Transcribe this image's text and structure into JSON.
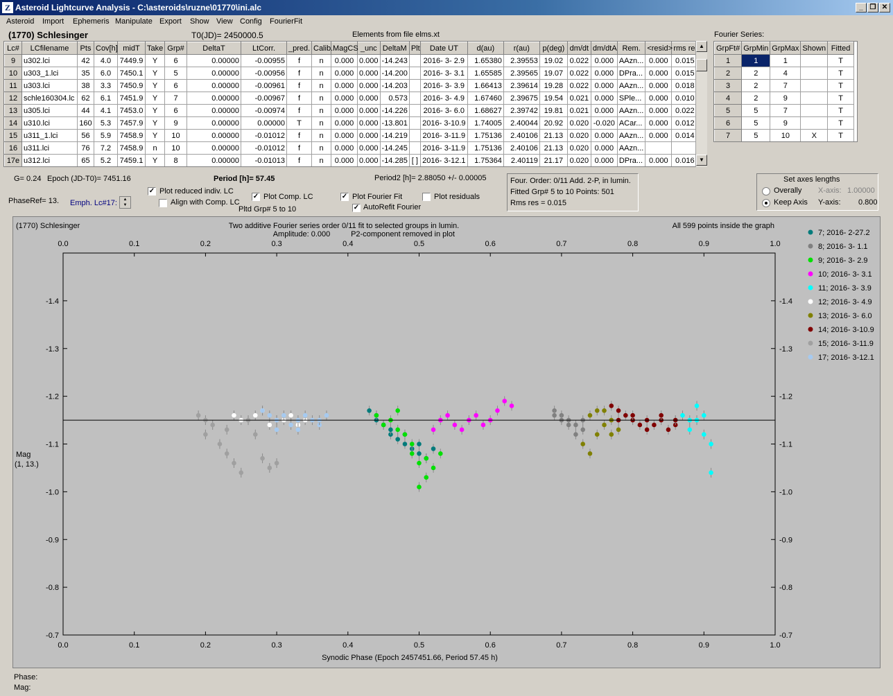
{
  "window": {
    "title": "Asteroid Lightcurve Analysis - C:\\asteroids\\ruzne\\01770\\ini.alc",
    "icon_text": "Z"
  },
  "menu": [
    "Asteroid",
    "Import",
    "Ephemeris",
    "Manipulate",
    "Export",
    "Show",
    "View",
    "Config",
    "FourierFit"
  ],
  "header": {
    "asteroid": "(1770) Schlesinger",
    "t0": "T0(JD)= 2450000.5",
    "elements": "Elements from file elms.xt"
  },
  "lc_table": {
    "columns": [
      "Lc#",
      "LCfilename",
      "Pts",
      "Cov[h]",
      "midT",
      "Take",
      "Grp#",
      "DeltaT",
      "LtCorr.",
      "_pred.",
      "Calib.",
      "MagCS",
      "_unc",
      "DeltaM",
      "Plt",
      "Date UT",
      "d(au)",
      "r(au)",
      "p(deg)",
      "dm/dt",
      "dm/dtA",
      "Rem.",
      "<resid>",
      "rms res"
    ],
    "rows": [
      [
        "9",
        "u302.lci",
        "42",
        "4.0",
        "7449.9",
        "Y",
        "6",
        "0.00000",
        "-0.00955",
        "f",
        "n",
        "0.000",
        "0.000",
        "-14.243",
        "",
        "2016- 3- 2.9",
        "1.65380",
        "2.39553",
        "19.02",
        "0.022",
        "0.000",
        "AAzn...",
        "0.000",
        "0.015"
      ],
      [
        "10",
        "u303_1.lci",
        "35",
        "6.0",
        "7450.1",
        "Y",
        "5",
        "0.00000",
        "-0.00956",
        "f",
        "n",
        "0.000",
        "0.000",
        "-14.200",
        "",
        "2016- 3- 3.1",
        "1.65585",
        "2.39565",
        "19.07",
        "0.022",
        "0.000",
        "DPra...",
        "0.000",
        "0.015"
      ],
      [
        "11",
        "u303.lci",
        "38",
        "3.3",
        "7450.9",
        "Y",
        "6",
        "0.00000",
        "-0.00961",
        "f",
        "n",
        "0.000",
        "0.000",
        "-14.203",
        "",
        "2016- 3- 3.9",
        "1.66413",
        "2.39614",
        "19.28",
        "0.022",
        "0.000",
        "AAzn...",
        "0.000",
        "0.018"
      ],
      [
        "12",
        "schle160304.lc",
        "62",
        "6.1",
        "7451.9",
        "Y",
        "7",
        "0.00000",
        "-0.00967",
        "f",
        "n",
        "0.000",
        "0.000",
        "0.573",
        "",
        "2016- 3- 4.9",
        "1.67460",
        "2.39675",
        "19.54",
        "0.021",
        "0.000",
        "SPle...",
        "0.000",
        "0.010"
      ],
      [
        "13",
        "u305.lci",
        "44",
        "4.1",
        "7453.0",
        "Y",
        "6",
        "0.00000",
        "-0.00974",
        "f",
        "n",
        "0.000",
        "0.000",
        "-14.226",
        "",
        "2016- 3- 6.0",
        "1.68627",
        "2.39742",
        "19.81",
        "0.021",
        "0.000",
        "AAzn...",
        "0.000",
        "0.022"
      ],
      [
        "14",
        "u310.lci",
        "160",
        "5.3",
        "7457.9",
        "Y",
        "9",
        "0.00000",
        "0.00000",
        "T",
        "n",
        "0.000",
        "0.000",
        "-13.801",
        "",
        "2016- 3-10.9",
        "1.74005",
        "2.40044",
        "20.92",
        "0.020",
        "-0.020",
        "ACar...",
        "0.000",
        "0.012"
      ],
      [
        "15",
        "u311_1.lci",
        "56",
        "5.9",
        "7458.9",
        "Y",
        "10",
        "0.00000",
        "-0.01012",
        "f",
        "n",
        "0.000",
        "0.000",
        "-14.219",
        "",
        "2016- 3-11.9",
        "1.75136",
        "2.40106",
        "21.13",
        "0.020",
        "0.000",
        "AAzn...",
        "0.000",
        "0.014"
      ],
      [
        "16",
        "u311.lci",
        "76",
        "7.2",
        "7458.9",
        "n",
        "10",
        "0.00000",
        "-0.01012",
        "f",
        "n",
        "0.000",
        "0.000",
        "-14.245",
        "",
        "2016- 3-11.9",
        "1.75136",
        "2.40106",
        "21.13",
        "0.020",
        "0.000",
        "AAzn...",
        "",
        ""
      ],
      [
        "17e",
        "u312.lci",
        "65",
        "5.2",
        "7459.1",
        "Y",
        "8",
        "0.00000",
        "-0.01013",
        "f",
        "n",
        "0.000",
        "0.000",
        "-14.285",
        "[ ]",
        "2016- 3-12.1",
        "1.75364",
        "2.40119",
        "21.17",
        "0.020",
        "0.000",
        "DPra...",
        "0.000",
        "0.016"
      ]
    ]
  },
  "fourier_table": {
    "caption": "Fourier Series:",
    "columns": [
      "GrpFt#",
      "GrpMin",
      "GrpMax",
      "Shown",
      "Fitted"
    ],
    "rows": [
      [
        "1",
        "1",
        "1",
        "",
        "T"
      ],
      [
        "2",
        "2",
        "4",
        "",
        "T"
      ],
      [
        "3",
        "2",
        "7",
        "",
        "T"
      ],
      [
        "4",
        "2",
        "9",
        "",
        "T"
      ],
      [
        "5",
        "5",
        "7",
        "",
        "T"
      ],
      [
        "6",
        "5",
        "9",
        "",
        "T"
      ],
      [
        "7",
        "5",
        "10",
        "X",
        "T"
      ]
    ]
  },
  "controls": {
    "g_value": "G= 0.24",
    "epoch": "Epoch (JD-T0)= 7451.16",
    "period": "Period [h]= 57.45",
    "period2": "Period2 [h]= 2.88050 +/- 0.00005",
    "phaseref": "PhaseRef= 13.",
    "emph": "Emph. Lc#17:",
    "plot_reduced": "Plot reduced indiv. LC",
    "align_comp": "Align with Comp. LC",
    "plot_comp": "Plot Comp. LC",
    "pltd_grp": "Pltd Grp#  5   to   10",
    "plot_fourier": "Plot Fourier Fit",
    "autorefit": "AutoRefit Fourier",
    "plot_residuals": "Plot residuals",
    "info1": "Four. Order:  0/11    Add. 2-P, in lumin.",
    "info2": "Fitted Grp# 5 to 10   Points: 501",
    "info3": "Rms res      = 0.015",
    "axes_title": "Set axes lengths",
    "overally": "Overally",
    "keep_axis": "Keep Axis",
    "xaxis_label": "X-axis:",
    "xaxis_val": "1.00000",
    "yaxis_label": "Y-axis:",
    "yaxis_val": "0.800",
    "check_mark": "✓",
    "phase": "Phase:",
    "mag": "Mag:"
  },
  "plot": {
    "name": "(1770) Schlesinger",
    "title1": "Two additive Fourier series order 0/11 fit to selected groups in lumin.",
    "title2": "Amplitude: 0.000",
    "title3": "P2-component removed in plot",
    "count": "All 599 points inside the graph",
    "xlabel": "Synodic Phase (Epoch 2457451.66, Period 57.45 h)",
    "ylabel1": "Mag",
    "ylabel2": "(1, 13.)"
  },
  "chart_data": {
    "type": "scatter",
    "xlim": [
      0,
      1
    ],
    "ylim": [
      -1.5,
      -0.7
    ],
    "y_inverted": true,
    "x_ticks": [
      "0.0",
      "0.1",
      "0.2",
      "0.3",
      "0.4",
      "0.5",
      "0.6",
      "0.7",
      "0.8",
      "0.9",
      "1.0"
    ],
    "y_ticks": [
      "-1.4",
      "-1.3",
      "-1.2",
      "-1.1",
      "-1.0",
      "-0.9",
      "-0.8",
      "-0.7"
    ],
    "fit_line_y": -1.15,
    "series": [
      {
        "name": "7; 2016- 2-27.2",
        "color": "#007b7b",
        "points": [
          [
            0.43,
            -1.17
          ],
          [
            0.44,
            -1.16
          ],
          [
            0.45,
            -1.14
          ],
          [
            0.46,
            -1.12
          ],
          [
            0.47,
            -1.11
          ],
          [
            0.48,
            -1.1
          ],
          [
            0.49,
            -1.09
          ],
          [
            0.5,
            -1.08
          ],
          [
            0.51,
            -1.07
          ],
          [
            0.52,
            -1.09
          ],
          [
            0.44,
            -1.15
          ],
          [
            0.46,
            -1.13
          ],
          [
            0.48,
            -1.12
          ],
          [
            0.5,
            -1.1
          ]
        ]
      },
      {
        "name": "8; 2016- 3- 1.1",
        "color": "#808080",
        "points": [
          [
            0.69,
            -1.17
          ],
          [
            0.7,
            -1.16
          ],
          [
            0.71,
            -1.15
          ],
          [
            0.72,
            -1.14
          ],
          [
            0.73,
            -1.13
          ],
          [
            0.7,
            -1.15
          ],
          [
            0.72,
            -1.12
          ],
          [
            0.71,
            -1.14
          ],
          [
            0.69,
            -1.16
          ],
          [
            0.73,
            -1.15
          ]
        ]
      },
      {
        "name": "9; 2016- 3- 2.9",
        "color": "#00e000",
        "points": [
          [
            0.44,
            -1.16
          ],
          [
            0.46,
            -1.15
          ],
          [
            0.47,
            -1.17
          ],
          [
            0.48,
            -1.12
          ],
          [
            0.49,
            -1.08
          ],
          [
            0.5,
            -1.06
          ],
          [
            0.51,
            -1.03
          ],
          [
            0.5,
            -1.01
          ],
          [
            0.52,
            -1.05
          ],
          [
            0.47,
            -1.13
          ],
          [
            0.49,
            -1.1
          ],
          [
            0.51,
            -1.07
          ],
          [
            0.53,
            -1.08
          ],
          [
            0.45,
            -1.14
          ]
        ]
      },
      {
        "name": "10; 2016- 3- 3.1",
        "color": "#ff00ff",
        "points": [
          [
            0.52,
            -1.13
          ],
          [
            0.53,
            -1.15
          ],
          [
            0.54,
            -1.16
          ],
          [
            0.55,
            -1.14
          ],
          [
            0.57,
            -1.15
          ],
          [
            0.58,
            -1.16
          ],
          [
            0.6,
            -1.15
          ],
          [
            0.61,
            -1.17
          ],
          [
            0.62,
            -1.19
          ],
          [
            0.63,
            -1.18
          ],
          [
            0.59,
            -1.14
          ],
          [
            0.56,
            -1.13
          ]
        ]
      },
      {
        "name": "11; 2016- 3- 3.9",
        "color": "#00ffff",
        "points": [
          [
            0.86,
            -1.15
          ],
          [
            0.87,
            -1.16
          ],
          [
            0.88,
            -1.15
          ],
          [
            0.89,
            -1.18
          ],
          [
            0.9,
            -1.16
          ],
          [
            0.9,
            -1.12
          ],
          [
            0.91,
            -1.1
          ],
          [
            0.91,
            -1.04
          ],
          [
            0.88,
            -1.13
          ],
          [
            0.89,
            -1.15
          ]
        ]
      },
      {
        "name": "12; 2016- 3- 4.9",
        "color": "#ffffff",
        "points": [
          [
            0.24,
            -1.16
          ],
          [
            0.25,
            -1.15
          ],
          [
            0.27,
            -1.16
          ],
          [
            0.28,
            -1.17
          ],
          [
            0.3,
            -1.15
          ],
          [
            0.32,
            -1.16
          ],
          [
            0.34,
            -1.15
          ],
          [
            0.29,
            -1.14
          ],
          [
            0.33,
            -1.14
          ],
          [
            0.31,
            -1.15
          ]
        ]
      },
      {
        "name": "13; 2016- 3- 6.0",
        "color": "#808000",
        "points": [
          [
            0.74,
            -1.16
          ],
          [
            0.75,
            -1.17
          ],
          [
            0.76,
            -1.14
          ],
          [
            0.75,
            -1.12
          ],
          [
            0.74,
            -1.08
          ],
          [
            0.77,
            -1.15
          ],
          [
            0.76,
            -1.17
          ],
          [
            0.78,
            -1.13
          ],
          [
            0.73,
            -1.1
          ],
          [
            0.77,
            -1.12
          ]
        ]
      },
      {
        "name": "14; 2016- 3-10.9",
        "color": "#800000",
        "points": [
          [
            0.77,
            -1.18
          ],
          [
            0.78,
            -1.17
          ],
          [
            0.79,
            -1.16
          ],
          [
            0.8,
            -1.15
          ],
          [
            0.81,
            -1.14
          ],
          [
            0.82,
            -1.15
          ],
          [
            0.83,
            -1.14
          ],
          [
            0.84,
            -1.15
          ],
          [
            0.85,
            -1.13
          ],
          [
            0.86,
            -1.14
          ],
          [
            0.8,
            -1.16
          ],
          [
            0.82,
            -1.13
          ],
          [
            0.84,
            -1.16
          ],
          [
            0.86,
            -1.15
          ],
          [
            0.78,
            -1.15
          ]
        ]
      },
      {
        "name": "15; 2016- 3-11.9",
        "color": "#a0a0a0",
        "points": [
          [
            0.19,
            -1.16
          ],
          [
            0.2,
            -1.15
          ],
          [
            0.21,
            -1.14
          ],
          [
            0.22,
            -1.1
          ],
          [
            0.23,
            -1.08
          ],
          [
            0.24,
            -1.06
          ],
          [
            0.25,
            -1.04
          ],
          [
            0.26,
            -1.15
          ],
          [
            0.27,
            -1.12
          ],
          [
            0.28,
            -1.07
          ],
          [
            0.29,
            -1.05
          ],
          [
            0.3,
            -1.06
          ],
          [
            0.2,
            -1.12
          ],
          [
            0.23,
            -1.13
          ]
        ]
      },
      {
        "name": "17; 2016- 3-12.1",
        "color": "#a6caf0",
        "points": [
          [
            0.28,
            -1.17
          ],
          [
            0.29,
            -1.16
          ],
          [
            0.3,
            -1.15
          ],
          [
            0.31,
            -1.16
          ],
          [
            0.32,
            -1.14
          ],
          [
            0.33,
            -1.15
          ],
          [
            0.34,
            -1.16
          ],
          [
            0.35,
            -1.15
          ],
          [
            0.36,
            -1.14
          ],
          [
            0.37,
            -1.16
          ],
          [
            0.3,
            -1.13
          ],
          [
            0.33,
            -1.13
          ],
          [
            0.36,
            -1.15
          ]
        ]
      }
    ]
  }
}
